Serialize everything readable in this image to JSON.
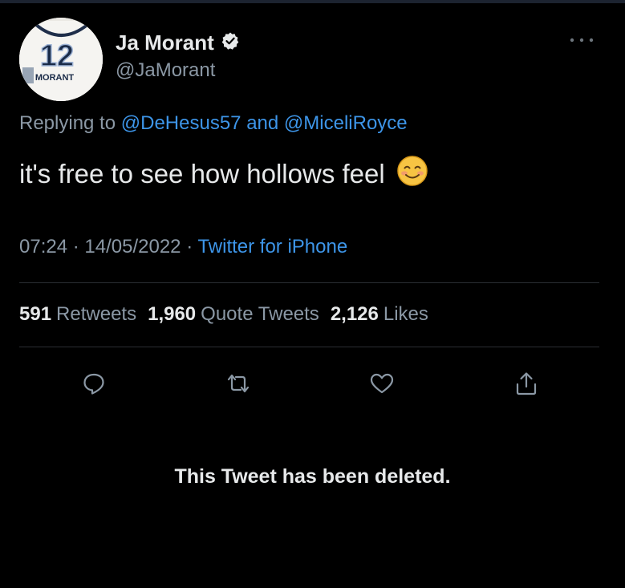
{
  "author": {
    "name": "Ja Morant",
    "handle": "@JaMorant",
    "verified": true,
    "avatar": {
      "jersey_number": "12",
      "jersey_name": "MORANT"
    }
  },
  "reply": {
    "prefix": "Replying to",
    "mention_1": "@DeHesus57",
    "conjunction": "and",
    "mention_2": "@MiceliRoyce"
  },
  "tweet": {
    "text": "it's free to see how hollows feel",
    "emoji": "smiling-face-icon"
  },
  "meta": {
    "time": "07:24",
    "date": "14/05/2022",
    "source": "Twitter for iPhone"
  },
  "stats": {
    "retweets_count": "591",
    "retweets_label": "Retweets",
    "quotes_count": "1,960",
    "quotes_label": "Quote Tweets",
    "likes_count": "2,126",
    "likes_label": "Likes"
  },
  "actions": [
    "reply-icon",
    "retweet-icon",
    "like-icon",
    "share-icon"
  ],
  "notice": "This Tweet has been deleted.",
  "colors": {
    "background": "#000000",
    "text": "#e7e9ea",
    "secondary": "#8b98a5",
    "link": "#3d95e8"
  }
}
